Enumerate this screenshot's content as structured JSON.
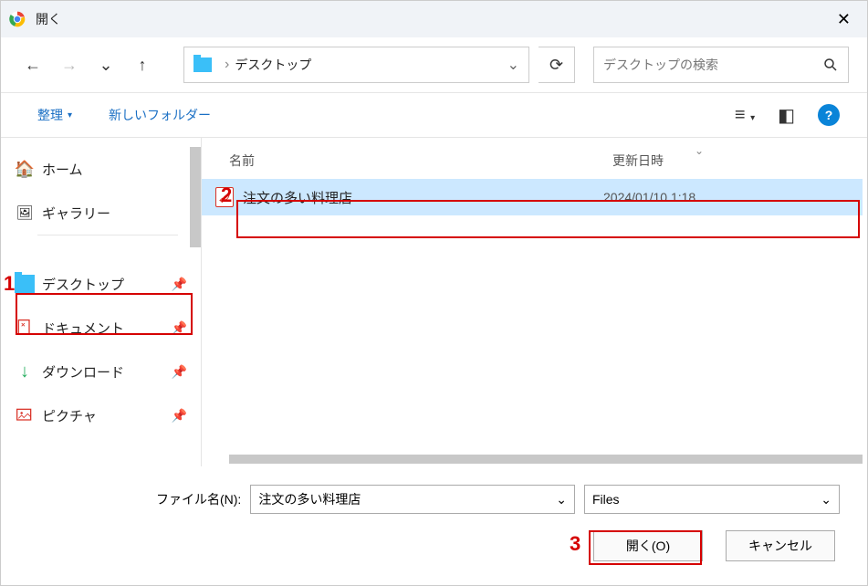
{
  "title": "開く",
  "nav": {
    "back": "←",
    "forward": "→",
    "recent": "⌄",
    "up": "↑",
    "refresh": "⟳"
  },
  "address": {
    "crumb_sep": "›",
    "path": "デスクトップ",
    "chevron": "⌄"
  },
  "search": {
    "placeholder": "デスクトップの検索"
  },
  "toolbar": {
    "organize": "整理",
    "organize_caret": "▾",
    "newfolder": "新しいフォルダー",
    "menu_caret": "▾",
    "help": "?"
  },
  "sidebar": {
    "home": "ホーム",
    "gallery": "ギャラリー",
    "desktop": "デスクトップ",
    "documents": "ドキュメント",
    "downloads": "ダウンロード",
    "download_glyph": "↓",
    "pictures": "ピクチャ",
    "pin": "📌"
  },
  "columns": {
    "name": "名前",
    "date": "更新日時",
    "sort": "⌄"
  },
  "files": [
    {
      "name": "注文の多い料理店",
      "date": "2024/01/10 1:18"
    }
  ],
  "footer": {
    "filename_label": "ファイル名(N):",
    "filename_value": "注文の多い料理店",
    "filetype": "Files",
    "open": "開く(O)",
    "cancel": "キャンセル",
    "chevron": "⌄"
  },
  "annotations": {
    "one": "1",
    "two": "2",
    "three": "3"
  }
}
